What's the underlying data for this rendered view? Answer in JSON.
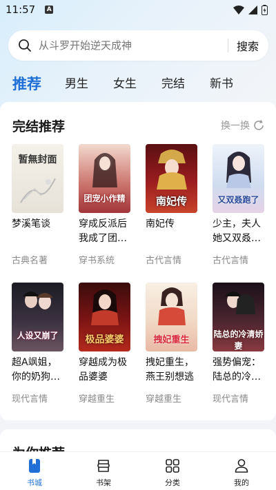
{
  "status": {
    "time": "11:57",
    "notif_letter": "A"
  },
  "search": {
    "placeholder": "从斗罗开始逆天成神",
    "button_label": "搜索"
  },
  "tabs": [
    {
      "label": "推荐",
      "active": true
    },
    {
      "label": "男生"
    },
    {
      "label": "女生"
    },
    {
      "label": "完结"
    },
    {
      "label": "新书"
    }
  ],
  "section": {
    "title": "完结推荐",
    "refresh_label": "换一换",
    "books": [
      {
        "title": "梦溪笔谈",
        "tag": "古典名著",
        "cover_text": "暂無封面"
      },
      {
        "title": "穿成反派后我成了团…",
        "tag": "穿书系统",
        "cover_text": "团宠小作精"
      },
      {
        "title": "南妃传",
        "tag": "古代言情",
        "cover_text": "南妃传"
      },
      {
        "title": "少主，夫人她又双叒…",
        "tag": "古代言情",
        "cover_text": "又双叒跑了"
      },
      {
        "title": "超A飒姐，你的奶狗…",
        "tag": "现代言情",
        "cover_text": "人设又崩了"
      },
      {
        "title": "穿越成为极品婆婆",
        "tag": "穿越重生",
        "cover_text": "极品婆婆"
      },
      {
        "title": "拽妃重生，燕王别想逃",
        "tag": "穿越重生",
        "cover_text": "拽妃重生"
      },
      {
        "title": "强势偏宠：陆总的冷…",
        "tag": "现代言情",
        "cover_text": "陆总的冷清娇妻"
      }
    ]
  },
  "section2": {
    "title": "为你推荐"
  },
  "bottom_nav": [
    {
      "label": "书城",
      "icon": "bookstore-icon",
      "active": true
    },
    {
      "label": "书架",
      "icon": "bookshelf-icon"
    },
    {
      "label": "分类",
      "icon": "category-grid-icon"
    },
    {
      "label": "我的",
      "icon": "profile-icon"
    }
  ],
  "colors": {
    "accent": "#1f6fd6",
    "tag_gray": "#8a8a8a"
  }
}
